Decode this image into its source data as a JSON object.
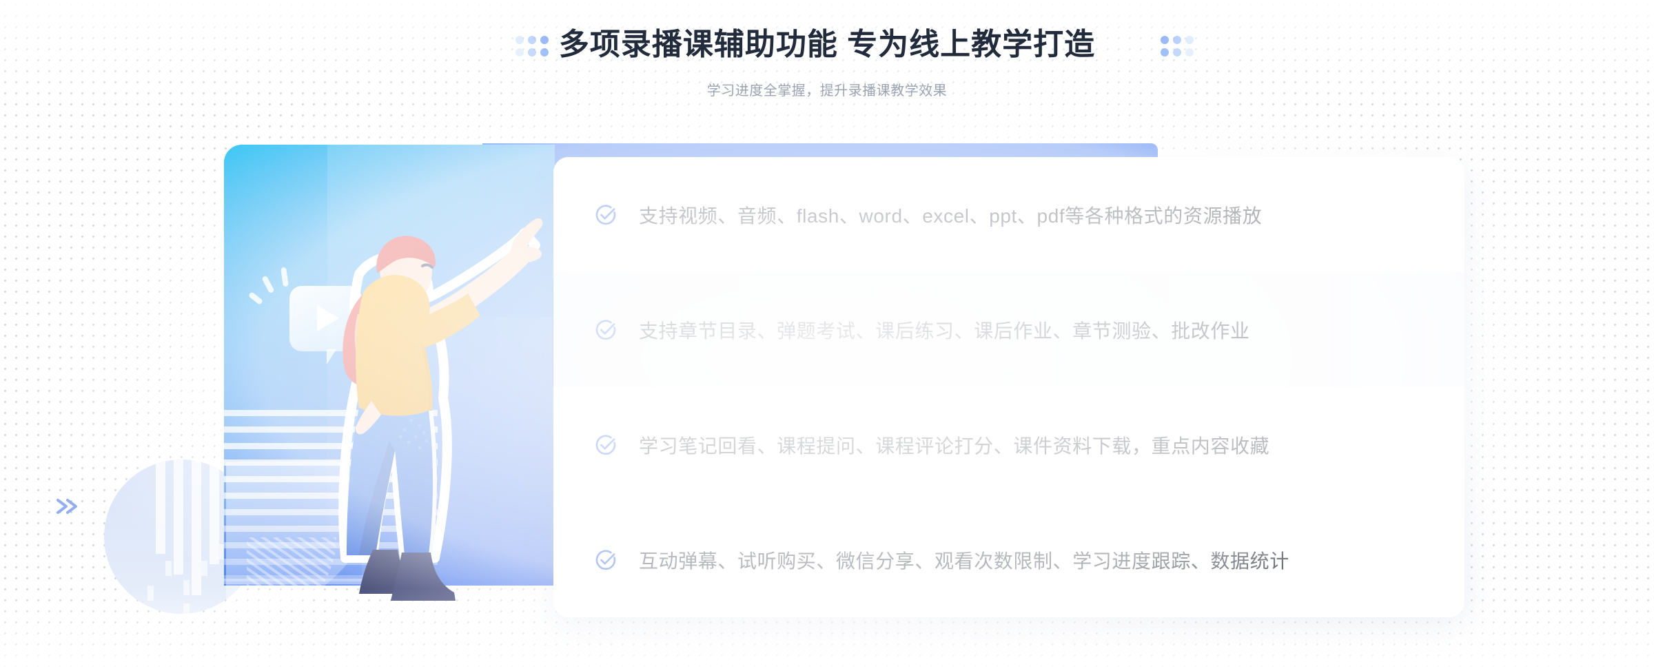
{
  "header": {
    "title": "多项录播课辅助功能 专为线上教学打造",
    "subtitle": "学习进度全掌握，提升录播课教学效果",
    "dot_decoration_color": "#5b93f5"
  },
  "illustration": {
    "name": "online-course-woman-pointing-illustration",
    "panel_gradient_from": "#36c5f4",
    "panel_gradient_to": "#2f62ec",
    "play_bubble_label": "play-button-speech-bubble",
    "figure_shirt_color": "#f5a623",
    "figure_hair_color": "#e8413d",
    "figure_pants_color": "#2f6fe8",
    "figure_shoes_color": "#1d2458"
  },
  "card": {
    "accent_color": "#2c5ae6",
    "check_icon_color": "#1a52e0",
    "highlight_row_index": 1,
    "features": [
      {
        "icon": "check-circle-icon",
        "text": "支持视频、音频、flash、word、excel、ppt、pdf等各种格式的资源播放"
      },
      {
        "icon": "check-circle-icon",
        "text": "支持章节目录、弹题考试、课后练习、课后作业、章节测验、批改作业"
      },
      {
        "icon": "check-circle-icon",
        "text": "学习笔记回看、课程提问、课程评论打分、课件资料下载，重点内容收藏"
      },
      {
        "icon": "check-circle-icon",
        "text": "互动弹幕、试听购买、微信分享、观看次数限制、学习进度跟踪、数据统计"
      }
    ]
  },
  "decorations": {
    "chevron_left": "double-chevron-right-icon",
    "chevron_inner": "double-chevron-left-icon",
    "circle_pattern": "striped-circle-decoration"
  }
}
